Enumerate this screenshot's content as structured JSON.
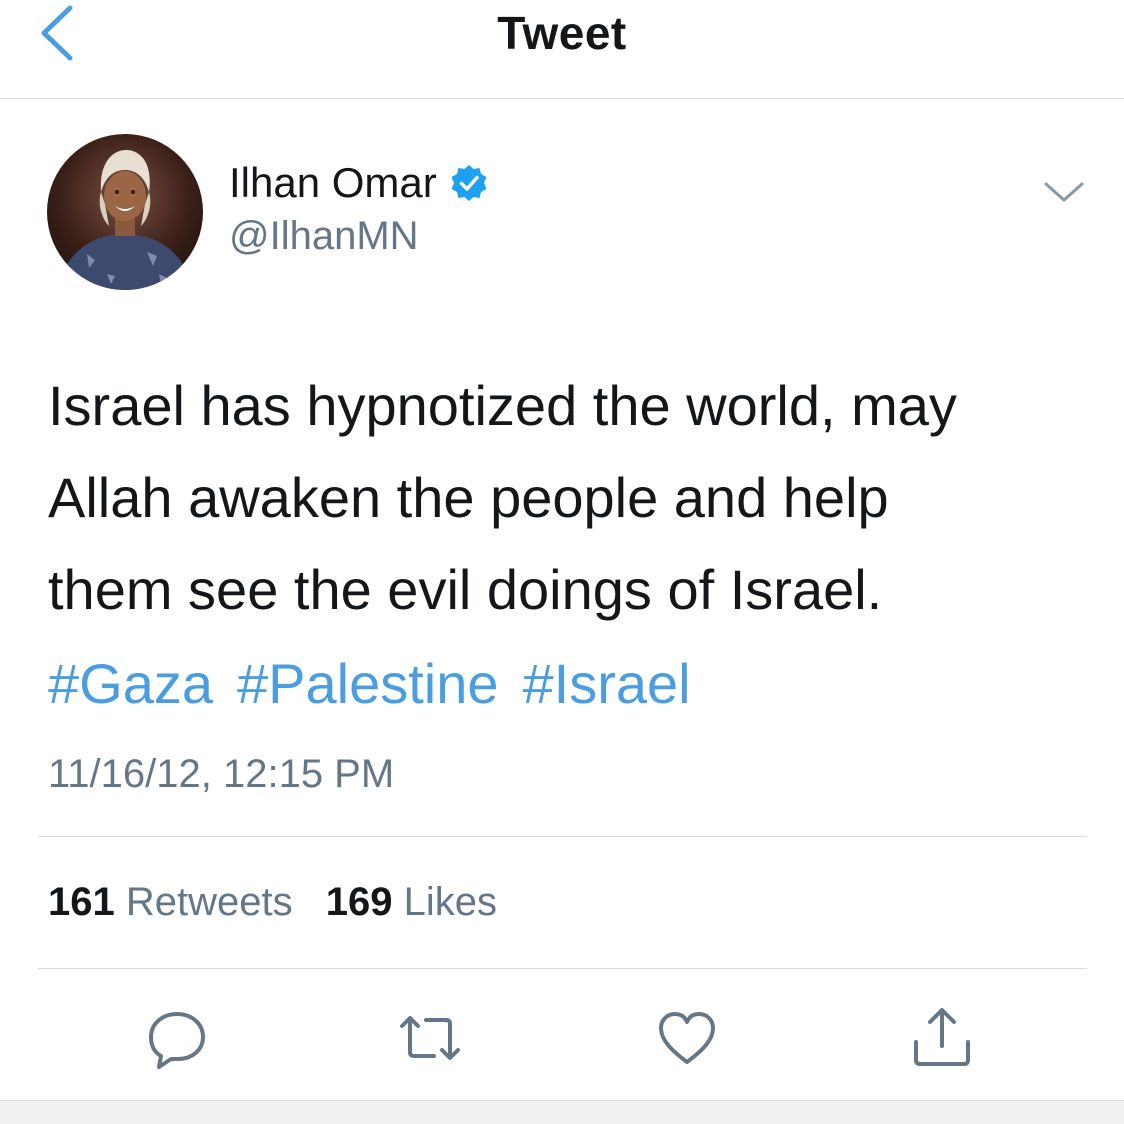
{
  "header": {
    "title": "Tweet"
  },
  "author": {
    "name": "Ilhan Omar",
    "handle": "@IlhanMN",
    "verified": true
  },
  "tweet": {
    "lines": [
      "Israel has hypnotized the world, may",
      "Allah awaken the people and help",
      "them see the evil doings of Israel."
    ],
    "hashtags": [
      "#Gaza",
      "#Palestine",
      "#Israel"
    ],
    "timestamp": "11/16/12, 12:15 PM"
  },
  "stats": {
    "retweets_count": "161",
    "retweets_label": "Retweets",
    "likes_count": "169",
    "likes_label": "Likes"
  },
  "actions": [
    "reply-icon",
    "retweet-icon",
    "like-icon",
    "share-icon"
  ],
  "colors": {
    "accent": "#4a9ee0",
    "verified": "#1da1f2",
    "secondary_text": "#657786",
    "primary_text": "#14171a"
  }
}
